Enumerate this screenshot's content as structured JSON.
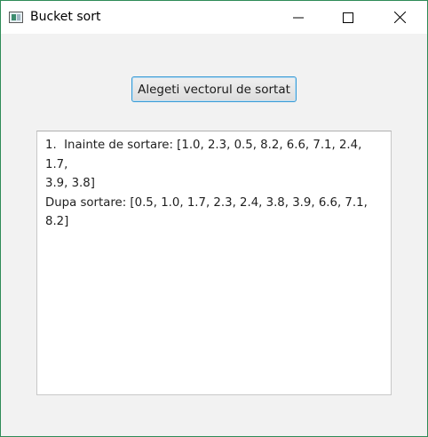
{
  "window": {
    "title": "Bucket sort",
    "icon": "java-app-icon"
  },
  "main": {
    "button_label": "Alegeti vectorul de sortat",
    "output_lines": [
      "1.  Inainte de sortare: [1.0, 2.3, 0.5, 8.2, 6.6, 7.1, 2.4, 1.7,",
      "3.9, 3.8]",
      "Dupa sortare: [0.5, 1.0, 1.7, 2.3, 2.4, 3.8, 3.9, 6.6, 7.1, 8.2]"
    ]
  }
}
